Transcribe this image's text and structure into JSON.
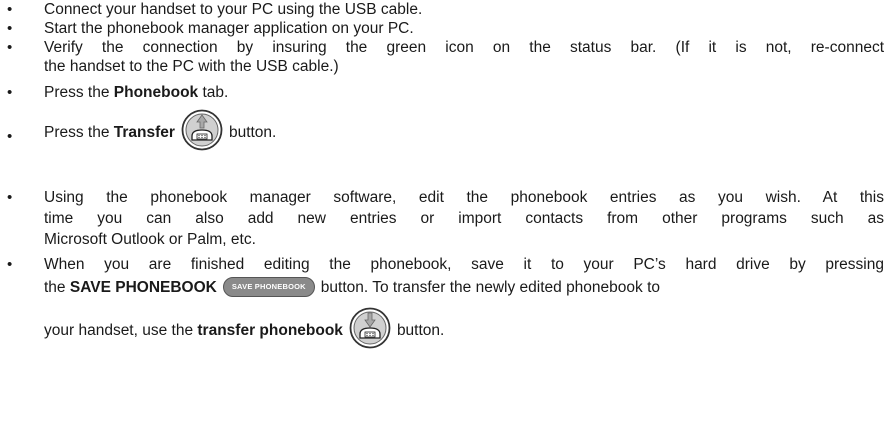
{
  "bullet_char": "•",
  "items": [
    {
      "text": "Connect your handset to your PC using the USB cable."
    },
    {
      "text": "Start the phonebook manager application on your PC."
    },
    {
      "line1": "Verify the connection by insuring the green icon on the status bar. (If it is not, re-connect",
      "line2": "the handset to the PC with the USB cable.)"
    },
    {
      "pre": "Press the ",
      "bold": "Phonebook",
      "post": " tab."
    },
    {
      "pre": "Press the ",
      "bold": "Transfer",
      "post": "button.",
      "icon": "transfer-phone-up-icon"
    },
    {
      "line1": "Using the phonebook manager software, edit the phonebook entries as you wish. At this",
      "line2": "time you can also add new entries or import contacts from other programs such as",
      "line3": "Microsoft Outlook or Palm, etc."
    },
    {
      "line1": "When you are finished editing the phonebook, save it to your PC’s hard drive by pressing",
      "line2_pre": "the ",
      "line2_bold": "SAVE PHONEBOOK",
      "save_button_label": "SAVE PHONEBOOK",
      "line2_post": "button. To transfer the newly edited phonebook to",
      "line3_pre": "your handset, use the ",
      "line3_bold": "transfer phonebook",
      "line3_post": "button.",
      "icon": "transfer-phone-down-icon"
    }
  ]
}
